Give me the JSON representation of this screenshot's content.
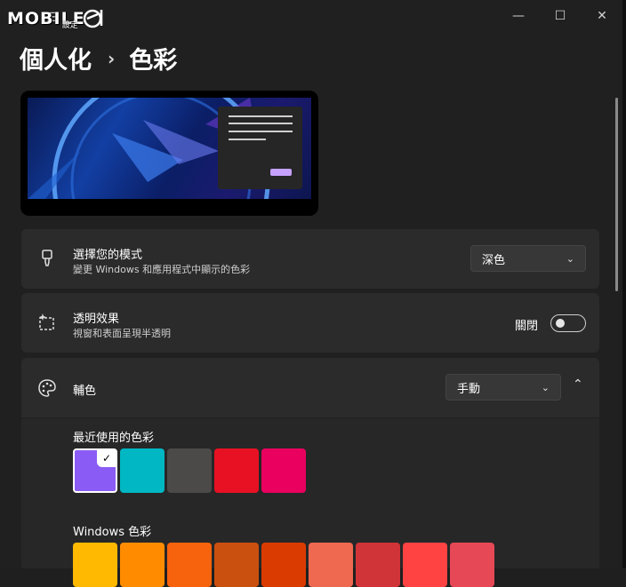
{
  "watermark": {
    "text": "MOBILE",
    "sub": "設定"
  },
  "titlebar": {
    "back": "←",
    "menu": "☰",
    "minimize": "—",
    "maximize": "☐",
    "close": "✕"
  },
  "breadcrumb": {
    "parent": "個人化",
    "separator": "›",
    "current": "色彩"
  },
  "mode": {
    "title": "選擇您的模式",
    "desc": "變更 Windows 和應用程式中顯示的色彩",
    "value": "深色"
  },
  "transparency": {
    "title": "透明效果",
    "desc": "視窗和表面呈現半透明",
    "state": "關閉",
    "on": false
  },
  "accent": {
    "title": "輔色",
    "value": "手動"
  },
  "recent": {
    "label": "最近使用的色彩",
    "colors": [
      "#8a5cf5",
      "#00b7c3",
      "#4c4a48",
      "#e81123",
      "#ea005e"
    ]
  },
  "windows_colors": {
    "label": "Windows 色彩",
    "colors": [
      "#ffb900",
      "#ff8c00",
      "#f7630c",
      "#ca5010",
      "#da3b01",
      "#ef6950",
      "#d13438",
      "#ff4343",
      "#e74856"
    ]
  },
  "accent_colors": {
    "toggle_highlight": "#c6a1ff"
  }
}
